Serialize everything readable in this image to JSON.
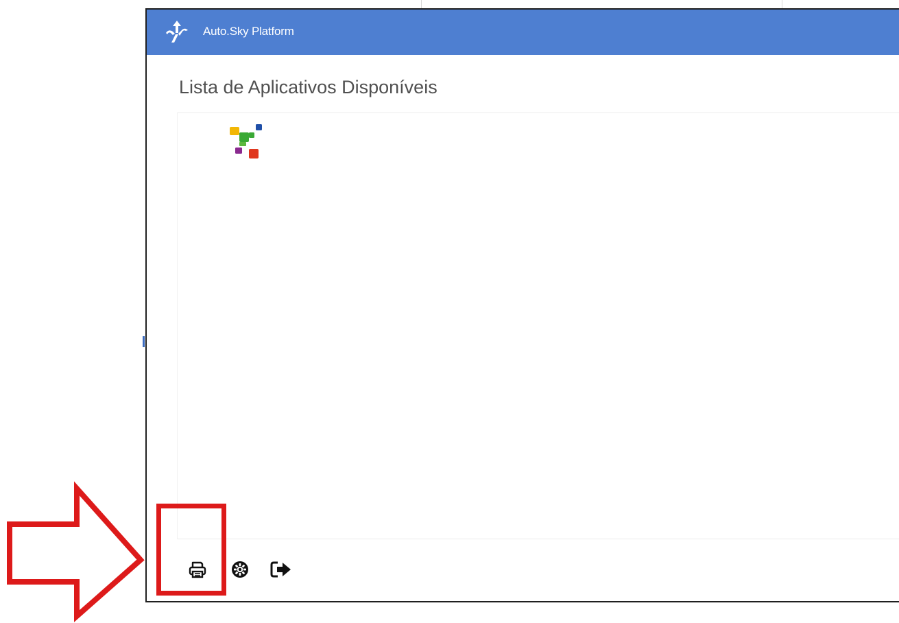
{
  "window": {
    "title": "Auto.Sky Platform",
    "titlebar_color": "#4e7fd1"
  },
  "main": {
    "heading": "Lista de Aplicativos Disponíveis"
  },
  "apps": [
    {
      "icon": "colored-squares-logo-icon"
    }
  ],
  "toolbar": {
    "items": [
      "printer-icon",
      "gear-icon",
      "sign-out-icon"
    ]
  },
  "annotation": {
    "color": "#dd1a1a",
    "shapes": [
      "arrow-right",
      "highlight-box"
    ]
  }
}
